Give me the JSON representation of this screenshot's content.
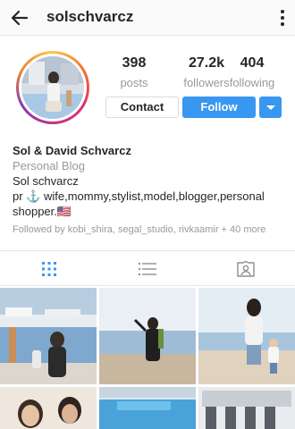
{
  "header": {
    "username": "solschvarcz",
    "back_icon": "arrow-left-icon",
    "more_icon": "more-vertical-icon"
  },
  "stats": {
    "posts": {
      "value": "398",
      "label": "posts"
    },
    "followers": {
      "value": "27.2k",
      "label": "followers"
    },
    "following": {
      "value": "404",
      "label": "following"
    }
  },
  "actions": {
    "contact_label": "Contact",
    "follow_label": "Follow",
    "dropdown_icon": "chevron-down-icon"
  },
  "bio": {
    "display_name": "Sol & David Schvarcz",
    "category": "Personal Blog",
    "line1": "Sol schvarcz",
    "line2": "pr ⚓ wife,mommy,stylist,model,blogger,personal shopper.🇺🇸",
    "followed_by": "Followed by kobi_shira, segal_studio, rivkaamir + 40 more"
  },
  "tabs": [
    {
      "name": "grid",
      "icon": "grid-icon",
      "active": true
    },
    {
      "name": "list",
      "icon": "list-icon",
      "active": false
    },
    {
      "name": "tagged",
      "icon": "tagged-person-icon",
      "active": false
    }
  ],
  "colors": {
    "accent": "#3897f0",
    "text": "#262626",
    "muted": "#999999"
  }
}
